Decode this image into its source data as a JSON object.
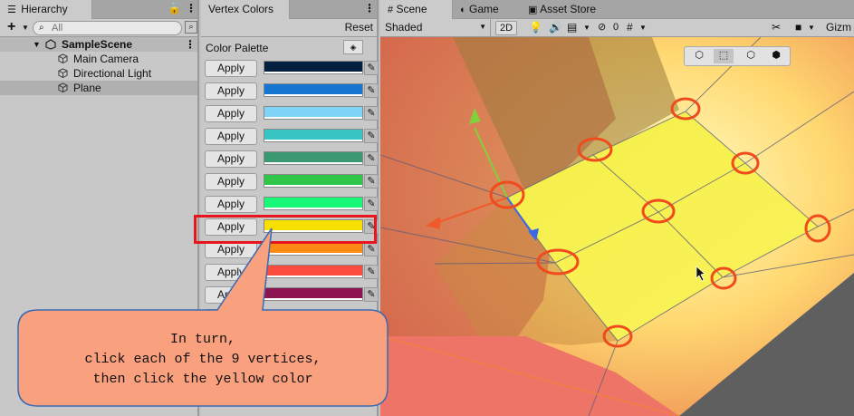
{
  "hierarchy": {
    "tab_label": "Hierarchy",
    "add_label": "+",
    "search_placeholder": "All",
    "scene_name": "SampleScene",
    "items": [
      "Main Camera",
      "Directional Light",
      "Plane"
    ],
    "selected_item": "Plane"
  },
  "vertex_colors": {
    "tab_label": "Vertex Colors",
    "reset_label": "Reset",
    "palette_label": "Color Palette",
    "apply_label": "Apply",
    "colors": [
      "#04203f",
      "#1576d2",
      "#7fd3f7",
      "#39c4c4",
      "#3a9873",
      "#2fc64a",
      "#17f778",
      "#f7df00",
      "#fd8a12",
      "#fb4b3f",
      "#8c1551",
      "#ffffff"
    ]
  },
  "scene": {
    "tabs": [
      "Scene",
      "Game",
      "Asset Store"
    ],
    "shading_mode": "Shaded",
    "mode_2d": "2D",
    "gizmo_count": "0",
    "gizmos_label": "Gizm"
  },
  "instruction": {
    "line1": "In turn,",
    "line2": "click each of the 9 vertices,",
    "line3": "then click the yellow color"
  },
  "accent_colors": {
    "highlight_box": "#e8141e",
    "vertex_ring": "#ef4b1d",
    "callout_fill": "#f9a07e",
    "callout_stroke": "#3a6ab4"
  }
}
